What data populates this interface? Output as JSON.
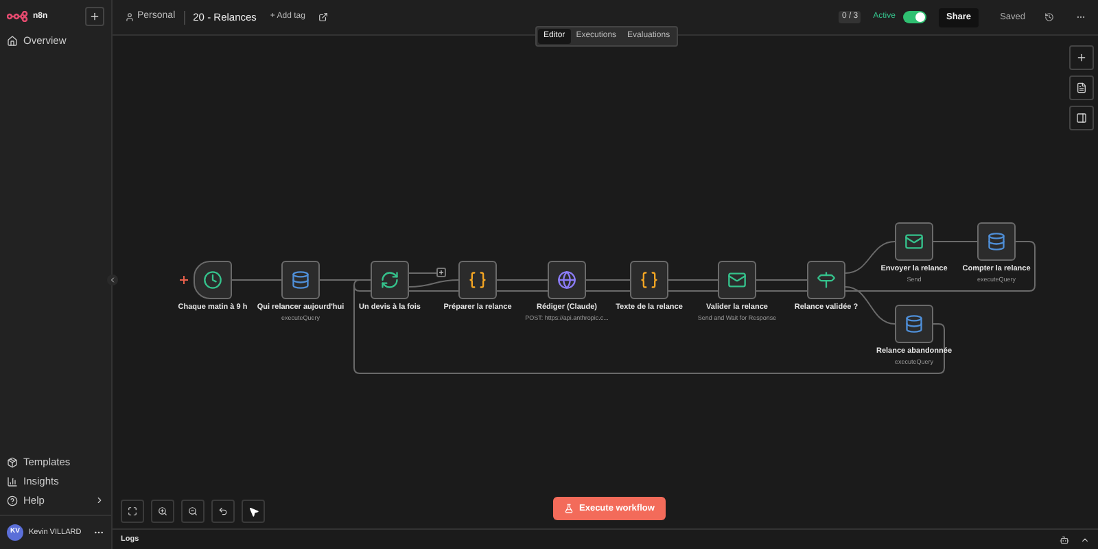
{
  "sidebar": {
    "logo": "n8n",
    "nav": [
      {
        "label": "Overview"
      }
    ],
    "bottom_nav": [
      {
        "label": "Templates",
        "has_submenu": false
      },
      {
        "label": "Insights",
        "has_submenu": false
      },
      {
        "label": "Help",
        "has_submenu": true
      }
    ],
    "user": {
      "initials": "KV",
      "name": "Kevin VILLARD"
    }
  },
  "header": {
    "project": "Personal",
    "workflow_name": "20 - Relances",
    "add_tag": "+ Add tag",
    "evaluations_count": "0 / 3",
    "active_label": "Active",
    "active": true,
    "share": "Share",
    "status": "Saved"
  },
  "tabs": [
    {
      "label": "Editor",
      "selected": true
    },
    {
      "label": "Executions",
      "selected": false
    },
    {
      "label": "Evaluations",
      "selected": false
    }
  ],
  "nodes": [
    {
      "label": "Chaque matin à 9 h",
      "kind": "schedule"
    },
    {
      "label": "Qui relancer aujourd'hui",
      "subtitle": "executeQuery",
      "kind": "postgres"
    },
    {
      "label": "Un devis à la fois",
      "kind": "loop"
    },
    {
      "label": "Préparer la relance",
      "kind": "code"
    },
    {
      "label": "Rédiger (Claude)",
      "subtitle": "POST: https://api.anthropic.c...",
      "kind": "http"
    },
    {
      "label": "Texte de la relance",
      "kind": "code"
    },
    {
      "label": "Valider la relance",
      "subtitle": "Send and Wait for Response",
      "kind": "mail"
    },
    {
      "label": "Relance validée ?",
      "kind": "if"
    },
    {
      "label": "Envoyer la relance",
      "subtitle": "Send",
      "kind": "mail"
    },
    {
      "label": "Compter la relance",
      "subtitle": "executeQuery",
      "kind": "postgres"
    },
    {
      "label": "Relance abandonnée",
      "subtitle": "executeQuery",
      "kind": "postgres"
    }
  ],
  "execute_button": "Execute workflow",
  "logs": {
    "title": "Logs"
  }
}
